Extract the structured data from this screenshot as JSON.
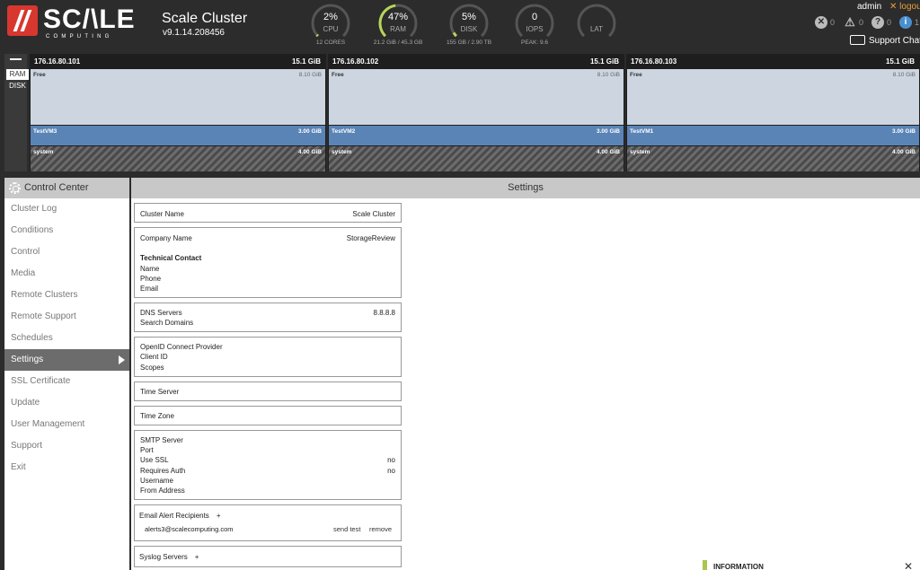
{
  "brand": {
    "word": "SC/\\LE",
    "sub": "COMPUTING"
  },
  "cluster": {
    "title": "Scale Cluster",
    "version": "v9.1.14.208456"
  },
  "gauges": [
    {
      "value": "2%",
      "label": "CPU",
      "sub": "12 CORES",
      "fill": 0.02
    },
    {
      "value": "47%",
      "label": "RAM",
      "sub": "21.2 GiB / 45.3 GB",
      "fill": 0.47
    },
    {
      "value": "5%",
      "label": "DISK",
      "sub": "155 GB / 2.90 TB",
      "fill": 0.05
    },
    {
      "value": "0",
      "label": "IOPS",
      "sub": "PEAK: 9.6",
      "fill": 0
    },
    {
      "value": "",
      "label": "LAT",
      "sub": "",
      "fill": 0
    }
  ],
  "colors": {
    "accent": "#b7d55b",
    "header_bg": "#2c2c2c",
    "vm": "#5b84b6",
    "free": "#cdd6e0",
    "logout": "#e8a23a"
  },
  "user": {
    "name": "admin",
    "logout": "✕ logout"
  },
  "status": {
    "errors": "0",
    "warnings": "0",
    "help": "0",
    "info": "1"
  },
  "support_chat": "Support Chat",
  "view_toggle": {
    "ram": "RAM",
    "disk": "DISK"
  },
  "nodes": [
    {
      "ip": "176.16.80.101",
      "total": "15.1 GiB",
      "free_label": "Free",
      "free_size": "8.10 GiB",
      "vm_name": "TestVM3",
      "vm_size": "3.00 GiB",
      "sys_label": "system",
      "sys_size": "4.00 GiB"
    },
    {
      "ip": "176.16.80.102",
      "total": "15.1 GiB",
      "free_label": "Free",
      "free_size": "8.10 GiB",
      "vm_name": "TestVM2",
      "vm_size": "3.00 GiB",
      "sys_label": "system",
      "sys_size": "4.00 GiB"
    },
    {
      "ip": "176.16.80.103",
      "total": "15.1 GiB",
      "free_label": "Free",
      "free_size": "8.10 GiB",
      "vm_name": "TestVM1",
      "vm_size": "3.00 GiB",
      "sys_label": "system",
      "sys_size": "4.00 GiB"
    }
  ],
  "sidebar": {
    "title": "Control Center",
    "items": [
      "Cluster Log",
      "Conditions",
      "Control",
      "Media",
      "Remote Clusters",
      "Remote Support",
      "Schedules",
      "Settings",
      "SSL Certificate",
      "Update",
      "User Management",
      "Support",
      "Exit"
    ],
    "active": "Settings"
  },
  "main": {
    "title": "Settings",
    "cluster_name": {
      "label": "Cluster Name",
      "value": "Scale Cluster"
    },
    "company": {
      "label": "Company Name",
      "value": "StorageReview",
      "contact_heading": "Technical Contact",
      "name": "Name",
      "phone": "Phone",
      "email": "Email"
    },
    "dns": {
      "servers_label": "DNS Servers",
      "servers_value": "8.8.8.8",
      "search_label": "Search Domains"
    },
    "openid": {
      "provider": "OpenID Connect Provider",
      "client": "Client ID",
      "scopes": "Scopes"
    },
    "time_server": "Time Server",
    "time_zone": "Time Zone",
    "smtp": {
      "server": "SMTP Server",
      "port": "Port",
      "ssl_label": "Use SSL",
      "ssl_value": "no",
      "auth_label": "Requires Auth",
      "auth_value": "no",
      "username": "Username",
      "from": "From Address"
    },
    "email_alerts": {
      "label": "Email Alert Recipients",
      "add": "+",
      "recipient": "alerts3@scalecomputing.com",
      "send_test": "send test",
      "remove": "remove"
    },
    "syslog": {
      "label": "Syslog Servers",
      "add": "+"
    }
  },
  "notification": {
    "text": "INFORMATION",
    "close": "✕"
  }
}
